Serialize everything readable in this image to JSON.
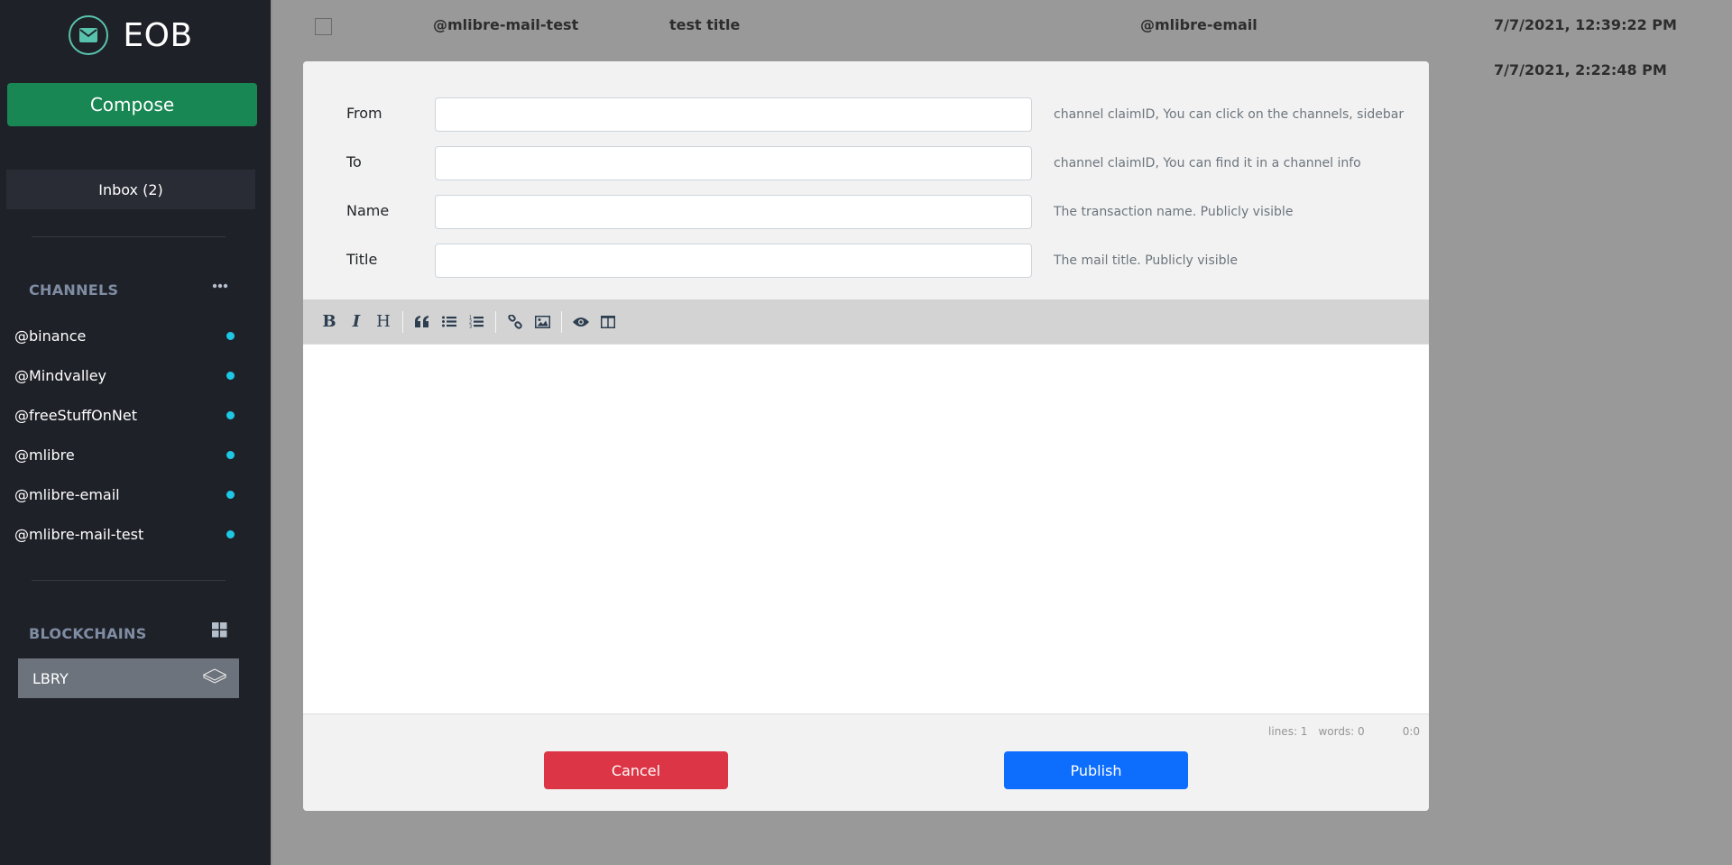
{
  "app": {
    "name": "EOB",
    "logo_icon": "envelope-icon"
  },
  "sidebar": {
    "compose_label": "Compose",
    "inbox_label": "Inbox (2)",
    "channels_title": "CHANNELS",
    "channels_menu_icon": "ellipsis-icon",
    "channels": [
      {
        "name": "@binance",
        "status_color": "#1ec8e4"
      },
      {
        "name": "@Mindvalley",
        "status_color": "#1ec8e4"
      },
      {
        "name": "@freeStuffOnNet",
        "status_color": "#1ec8e4"
      },
      {
        "name": "@mlibre",
        "status_color": "#1ec8e4"
      },
      {
        "name": "@mlibre-email",
        "status_color": "#1ec8e4"
      },
      {
        "name": "@mlibre-mail-test",
        "status_color": "#1ec8e4"
      }
    ],
    "blockchains_title": "BLOCKCHAINS",
    "blockchains_icon": "grid-icon",
    "blockchains": [
      {
        "name": "LBRY",
        "icon": "layer-icon"
      }
    ]
  },
  "mail_list": [
    {
      "from": "@mlibre-mail-test",
      "title": "test title",
      "to": "@mlibre-email",
      "date": "7/7/2021, 12:39:22 PM"
    },
    {
      "from": "",
      "title": "",
      "to": "",
      "date": "7/7/2021, 2:22:48 PM"
    }
  ],
  "compose_modal": {
    "fields": [
      {
        "label": "From",
        "value": "",
        "hint": "channel claimID, You can click on the channels, sidebar"
      },
      {
        "label": "To",
        "value": "",
        "hint": "channel claimID, You can find it in a channel info"
      },
      {
        "label": "Name",
        "value": "",
        "hint": "The transaction name. Publicly visible"
      },
      {
        "label": "Title",
        "value": "",
        "hint": "The mail title. Publicly visible"
      }
    ],
    "toolbar": {
      "bold": "B",
      "italic": "I",
      "heading": "H"
    },
    "editor_content": "",
    "status": {
      "lines": "lines: 1",
      "words": "words: 0",
      "cursor": "0:0"
    },
    "cancel_label": "Cancel",
    "publish_label": "Publish"
  },
  "colors": {
    "compose": "#198754",
    "cancel": "#dc3545",
    "publish": "#0d6efd",
    "accent": "#58c3ad"
  }
}
